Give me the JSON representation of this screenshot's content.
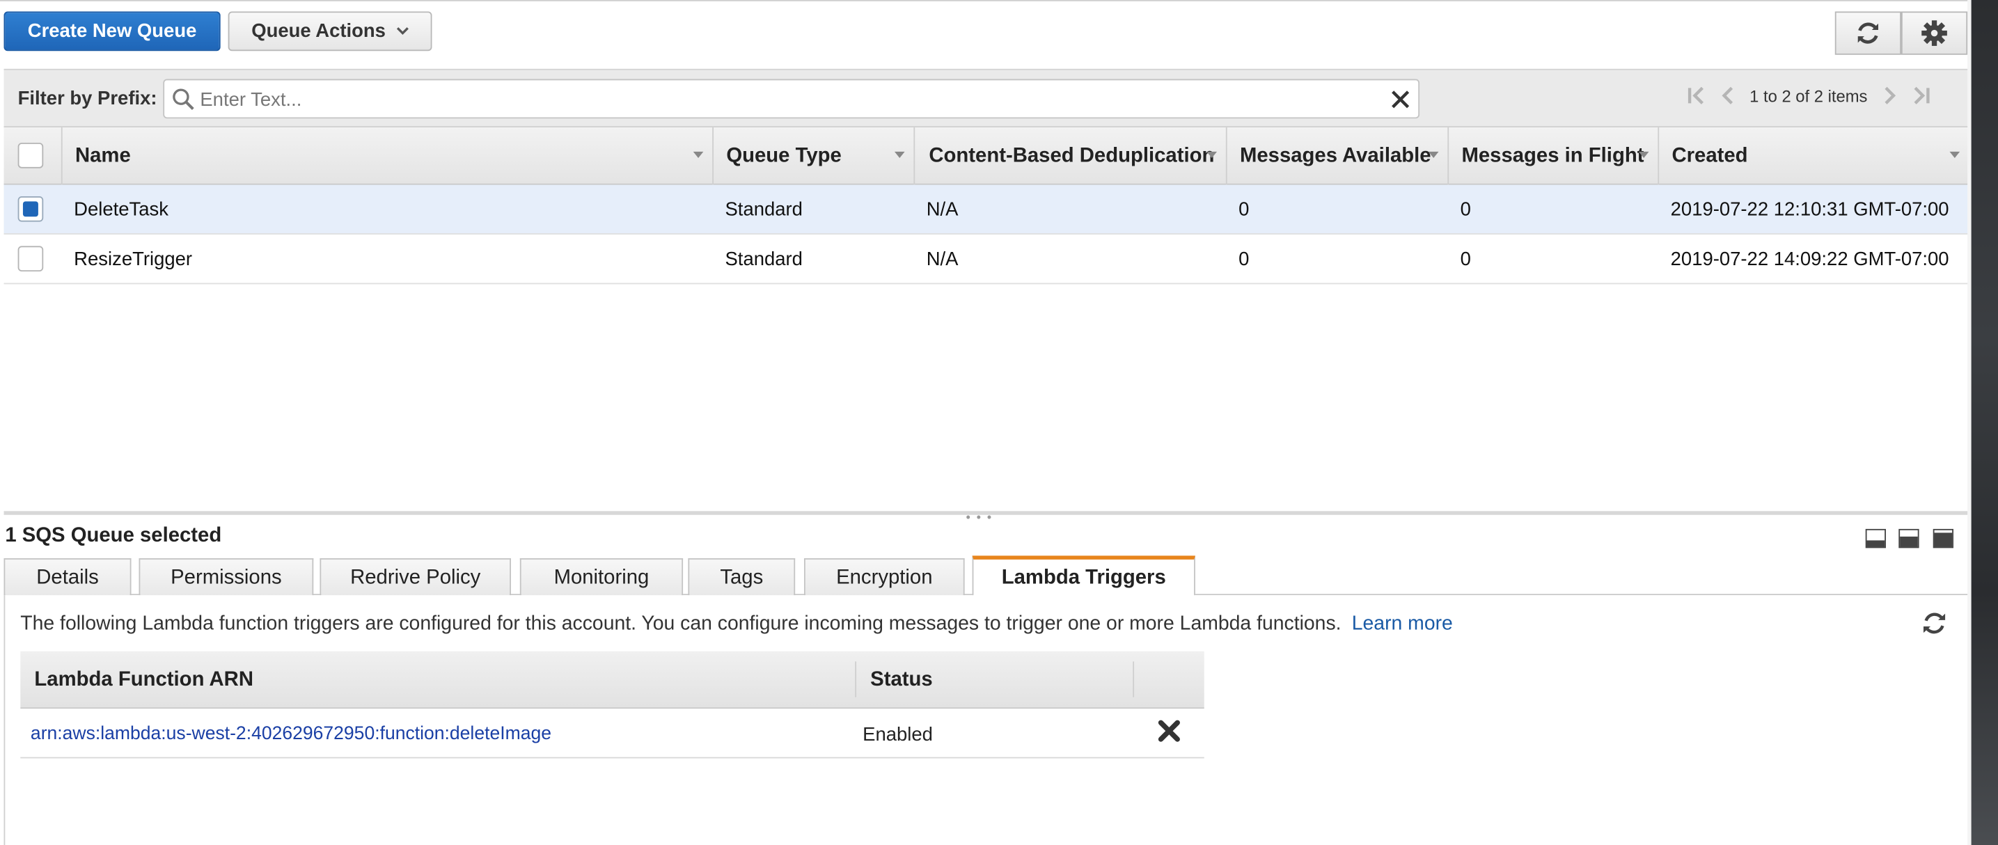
{
  "toolbar": {
    "create_label": "Create New Queue",
    "actions_label": "Queue Actions"
  },
  "filter": {
    "label": "Filter by Prefix:",
    "placeholder": "Enter Text...",
    "pager_text": "1 to 2 of 2 items"
  },
  "table": {
    "columns": [
      "Name",
      "Queue Type",
      "Content-Based Deduplication",
      "Messages Available",
      "Messages in Flight",
      "Created"
    ],
    "rows": [
      {
        "selected": true,
        "name": "DeleteTask",
        "queue_type": "Standard",
        "dedup": "N/A",
        "available": "0",
        "in_flight": "0",
        "created": "2019-07-22 12:10:31 GMT-07:00"
      },
      {
        "selected": false,
        "name": "ResizeTrigger",
        "queue_type": "Standard",
        "dedup": "N/A",
        "available": "0",
        "in_flight": "0",
        "created": "2019-07-22 14:09:22 GMT-07:00"
      }
    ]
  },
  "details": {
    "selection_title": "1 SQS Queue selected",
    "tabs": [
      "Details",
      "Permissions",
      "Redrive Policy",
      "Monitoring",
      "Tags",
      "Encryption",
      "Lambda Triggers"
    ],
    "active_tab": "Lambda Triggers",
    "info_text": "The following Lambda function triggers are configured for this account. You can configure incoming messages to trigger one or more Lambda functions.",
    "learn_more": "Learn more",
    "lambda_table": {
      "columns": [
        "Lambda Function ARN",
        "Status"
      ],
      "rows": [
        {
          "arn": "arn:aws:lambda:us-west-2:402629672950:function:deleteImage",
          "status": "Enabled"
        }
      ]
    }
  },
  "colors": {
    "primary": "#1f66b8",
    "active_tab_accent": "#e8851c",
    "selected_row": "#e6eefa",
    "link": "#1a3fa5"
  }
}
